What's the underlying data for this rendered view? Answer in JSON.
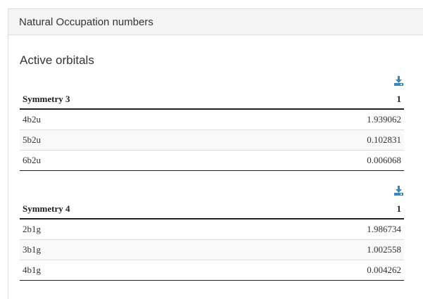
{
  "panel": {
    "heading": "Natural Occupation numbers"
  },
  "section": {
    "title": "Active orbitals"
  },
  "icons": {
    "download": "download-icon",
    "accent_color": "#3a87c0"
  },
  "tables": [
    {
      "symmetry": "Symmetry 3",
      "column": "1",
      "rows": [
        {
          "orbital": "4b2u",
          "value": "1.939062"
        },
        {
          "orbital": "5b2u",
          "value": "0.102831"
        },
        {
          "orbital": "6b2u",
          "value": "0.006068"
        }
      ]
    },
    {
      "symmetry": "Symmetry 4",
      "column": "1",
      "rows": [
        {
          "orbital": "2b1g",
          "value": "1.986734"
        },
        {
          "orbital": "3b1g",
          "value": "1.002558"
        },
        {
          "orbital": "4b1g",
          "value": "0.004262"
        }
      ]
    }
  ]
}
